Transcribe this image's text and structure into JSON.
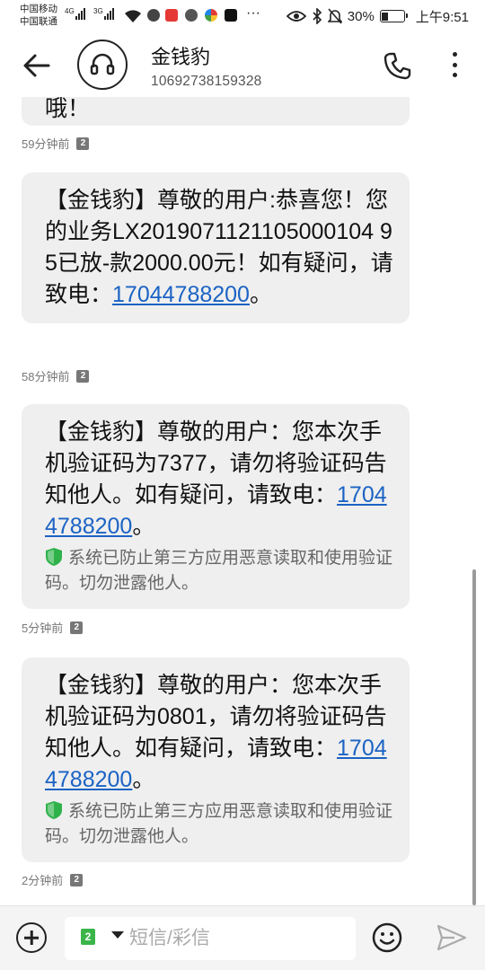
{
  "status_bar": {
    "carrier1": "中国移动",
    "carrier2": "中国联通",
    "net1": "4G",
    "net2": "3G",
    "battery_text": "30%",
    "battery_level": 0.3,
    "time": "上午9:51",
    "icons": [
      "signal-icon",
      "wifi-icon",
      "app-icon",
      "eye-icon",
      "bluetooth-icon",
      "mute-icon",
      "battery-icon"
    ]
  },
  "header": {
    "contact_name": "金钱豹",
    "contact_number": "10692738159328"
  },
  "messages": [
    {
      "text": "哦！",
      "time": "59分钟前",
      "sim": "2"
    },
    {
      "text_before": "【金钱豹】尊敬的用户:恭喜您！您的业务LX2019071121105000104 95已放-款2000.00元！如有疑问，请致电：",
      "phone": "17044788200",
      "text_after": "。",
      "time": "58分钟前",
      "sim": "2"
    },
    {
      "text_before": "【金钱豹】尊敬的用户：您本次手机验证码为7377，请勿将验证码告知他人。如有疑问，请致电：",
      "phone": "17044788200",
      "text_after": "。",
      "notice": "系统已防止第三方应用恶意读取和使用验证码。切勿泄露他人。",
      "time": "5分钟前",
      "sim": "2"
    },
    {
      "text_before": "【金钱豹】尊敬的用户：您本次手机验证码为0801，请勿将验证码告知他人。如有疑问，请致电：",
      "phone": "17044788200",
      "text_after": "。",
      "notice": "系统已防止第三方应用恶意读取和使用验证码。切勿泄露他人。",
      "time": "2分钟前",
      "sim": "2"
    }
  ],
  "input_bar": {
    "placeholder": "短信/彩信",
    "sim_selected": "2",
    "sim_other": "1"
  },
  "colors": {
    "link": "#1b63c4",
    "bubble": "#efefef",
    "shield": "#2fb24a",
    "sim_active": "#3bb54a"
  }
}
